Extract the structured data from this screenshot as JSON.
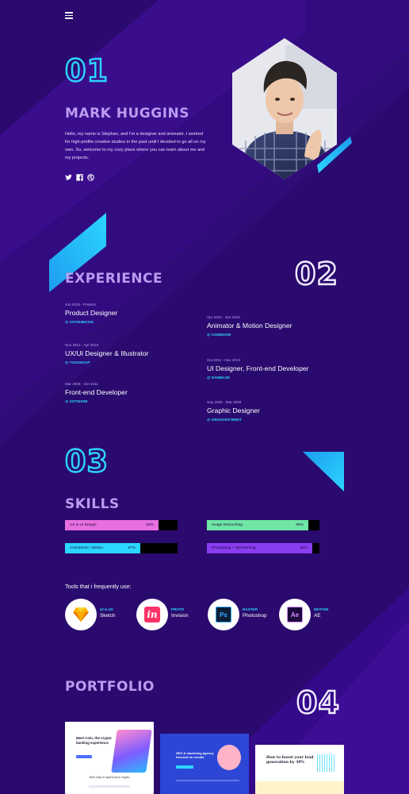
{
  "colors": {
    "background": "#2a0a6e",
    "accent_cyan": "#2bd6ff",
    "heading_purple": "#b99cf0"
  },
  "nav": {
    "menu_icon": "hamburger-menu-icon"
  },
  "hero": {
    "number": "01",
    "name": "MARK HUGGINS",
    "bio": "Hello, my name is Stephan, and I'm a designer and animator. I worked for high-profile creative studios in the past until I decided to go all on my own. So, welcome to my cozy place where you can learn about me and my projects.",
    "social_icons": [
      "twitter-icon",
      "facebook-icon",
      "dribbble-icon"
    ]
  },
  "experience": {
    "number": "02",
    "heading": "EXPERIENCE",
    "left": [
      {
        "dates": "Jun 2018 - Present",
        "title": "Product Designer",
        "company": "@ ZATHUNICON"
      },
      {
        "dates": "Nov 2014 - Apr 2016",
        "title": "UX/UI Designer & Illustrator",
        "company": "@ TOUGHZAP"
      },
      {
        "dates": "Mar 2008 - Oct 2011",
        "title": "Front-end Developer",
        "company": "@ ZOTWARE"
      }
    ],
    "right": [
      {
        "dates": "Apr 2016 - Jun 2018",
        "title": "Animator & Motion Designer",
        "company": "@ CODEHOW"
      },
      {
        "dates": "Oct 2011 - Nov 2014",
        "title": "UI Designer, Front-end Developer",
        "company": "@ DAMBASE"
      },
      {
        "dates": "Sep 2006 - Mar 2008",
        "title": "Graphic Designer",
        "company": "@ GROOVESTREET"
      }
    ]
  },
  "skills": {
    "number": "03",
    "heading": "SKILLS",
    "bars": [
      {
        "label": "UX & UI Design",
        "percent_label": "83%",
        "value": 83,
        "color": "#e86fe0"
      },
      {
        "label": "Image Retouching",
        "percent_label": "90%",
        "value": 90,
        "color": "#6fe6a4"
      },
      {
        "label": "Animations / Motion",
        "percent_label": "67%",
        "value": 67,
        "color": "#2bd6ff"
      },
      {
        "label": "Prototyping + Wireframing",
        "percent_label": "94%",
        "value": 94,
        "color": "#8a3cf0"
      }
    ],
    "tools_title": "Tools that i frequently use:",
    "tools": [
      {
        "category": "UI & UX",
        "name": "Sketch",
        "icon": "sketch-icon"
      },
      {
        "category": "PROTO",
        "name": "Invision",
        "icon": "invision-icon"
      },
      {
        "category": "RASTER",
        "name": "Photoshop",
        "icon": "photoshop-icon"
      },
      {
        "category": "MOTION",
        "name": "AE",
        "icon": "after-effects-icon"
      }
    ]
  },
  "portfolio": {
    "number": "04",
    "heading": "PORTFOLIO",
    "items": [
      {
        "headline": "Meet Coin, the crypto banking experience",
        "caption": "New way to spend your crypto"
      },
      {
        "headline": "SEO & marketing agency focused on results"
      },
      {
        "headline": "How to boost your lead generation by 30%"
      }
    ]
  }
}
